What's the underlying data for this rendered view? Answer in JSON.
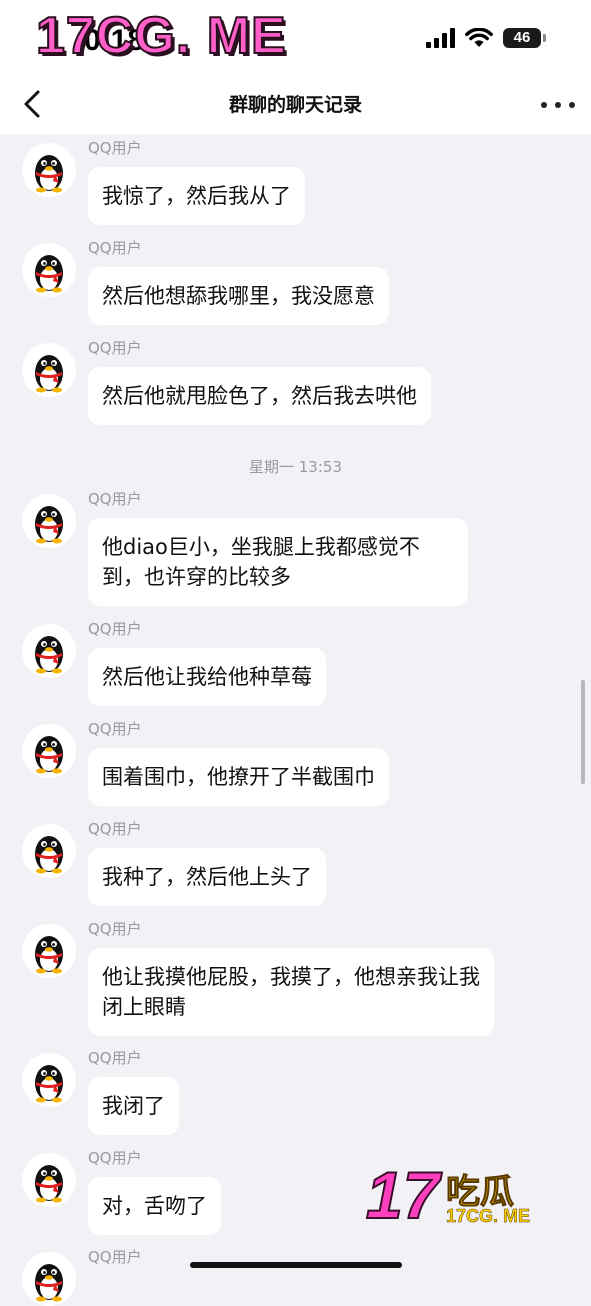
{
  "status_bar": {
    "time": "0:18",
    "battery": "46",
    "watermark": "17CG. ME"
  },
  "nav": {
    "title": "群聊的聊天记录"
  },
  "messages": [
    {
      "sender": "QQ用户",
      "text": "我惊了，然后我从了"
    },
    {
      "sender": "QQ用户",
      "text": "然后他想舔我哪里，我没愿意"
    },
    {
      "sender": "QQ用户",
      "text": "然后他就甩脸色了，然后我去哄他"
    },
    {
      "sender": "QQ用户",
      "text": "他diao巨小，坐我腿上我都感觉不到，也许穿的比较多"
    },
    {
      "sender": "QQ用户",
      "text": "然后他让我给他种草莓"
    },
    {
      "sender": "QQ用户",
      "text": "围着围巾，他撩开了半截围巾"
    },
    {
      "sender": "QQ用户",
      "text": "我种了，然后他上头了"
    },
    {
      "sender": "QQ用户",
      "text": "他让我摸他屁股，我摸了，他想亲我让我闭上眼睛"
    },
    {
      "sender": "QQ用户",
      "text": "我闭了"
    },
    {
      "sender": "QQ用户",
      "text": "对，舌吻了"
    },
    {
      "sender": "QQ用户",
      "text": ""
    }
  ],
  "timestamp": "星期一 13:53",
  "watermark_corner": {
    "big": "17",
    "cn": "吃瓜",
    "small": "17CG. ME"
  }
}
